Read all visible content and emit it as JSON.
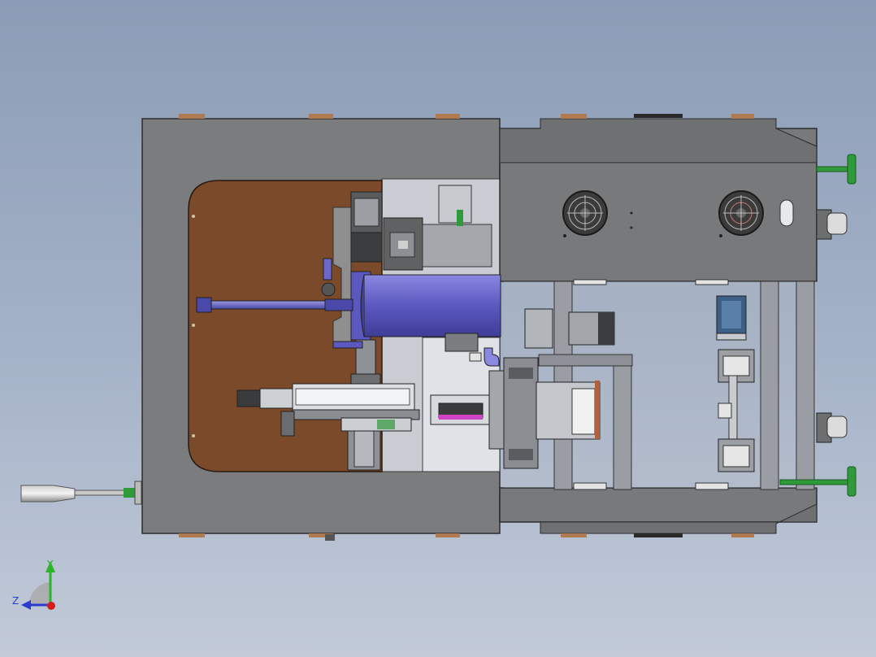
{
  "viewport": {
    "background_top": "#8b9cb6",
    "background_bottom": "#c2cad8",
    "model_description_icon": "machine-cad-assembly"
  },
  "colors": {
    "frame_gray": "#77797b",
    "frame_dark": "#4a4c4e",
    "panel_brown": "#7b4a2a",
    "cylinder_blue": "#6b68c9",
    "handle_green": "#2f9a3a",
    "inner_light": "#c8ccd2",
    "fan_dark": "#3a3a3a"
  },
  "triad": {
    "y_label": "Y",
    "z_label": "Z",
    "y_color": "#2ab52a",
    "z_color": "#2a3ccf",
    "x_color": "#d41c1c"
  }
}
